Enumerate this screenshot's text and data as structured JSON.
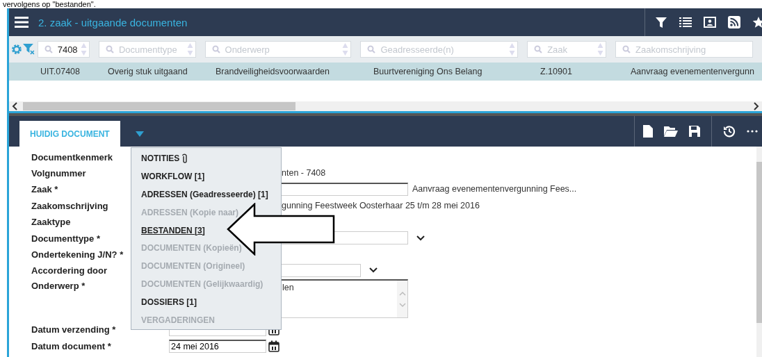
{
  "caption": "vervolgens op \"bestanden\".",
  "window": {
    "title": "2. zaak - uitgaande documenten"
  },
  "filters": [
    {
      "value": "7408"
    },
    {
      "placeholder": "Documenttype"
    },
    {
      "placeholder": "Onderwerp"
    },
    {
      "placeholder": "Geadresseerde(n)"
    },
    {
      "placeholder": "Zaak"
    },
    {
      "placeholder": "Zaakomschrijving"
    }
  ],
  "table": {
    "rows": [
      {
        "selected": true,
        "cells": [
          "UIT.07408",
          "Overig stuk uitgaand",
          "Brandveiligheidsvoorwaarden",
          "Buurtvereniging Ons Belang",
          "Z.10901",
          "Aanvraag evenementenvergunn"
        ]
      }
    ]
  },
  "tabs": [
    {
      "label": "HUIDIG DOCUMENT",
      "selected": true
    }
  ],
  "form": [
    {
      "label": "Documentkenmerk",
      "kind": "none"
    },
    {
      "label": "Volgnummer",
      "kind": "text",
      "value": "nten - 7408"
    },
    {
      "label": "Zaak *",
      "kind": "lookup",
      "value": "Aanvraag evenementenvergunning Fees..."
    },
    {
      "label": "Zaakomschrijving",
      "kind": "text",
      "value": "gunning Feestweek Oosterhaar 25 t/m 28 mei 2016"
    },
    {
      "label": "Zaaktype",
      "kind": "none"
    },
    {
      "label": "Documenttype *",
      "kind": "select"
    },
    {
      "label": "Ondertekening J/N? *",
      "kind": "none"
    },
    {
      "label": "Accordering door",
      "kind": "select-short"
    },
    {
      "label": "Onderwerp *",
      "kind": "textarea",
      "value": "len"
    },
    {
      "label": "Datum verzending *",
      "kind": "date"
    },
    {
      "label": "Datum document *",
      "kind": "date",
      "value": "24 mei 2016"
    }
  ],
  "menu": [
    {
      "label": "NOTITIES",
      "disabled": false,
      "selected": false,
      "attachment": true
    },
    {
      "label": "WORKFLOW [1]",
      "disabled": false,
      "selected": false,
      "attachment": false
    },
    {
      "label": "ADRESSEN (Geadresseerde) [1]",
      "disabled": false,
      "selected": false,
      "attachment": false
    },
    {
      "label": "ADRESSEN (Kopie naar)",
      "disabled": true,
      "selected": false,
      "attachment": false
    },
    {
      "label": "BESTANDEN [3]",
      "disabled": false,
      "selected": true,
      "attachment": false
    },
    {
      "label": "DOCUMENTEN (Kopieën)",
      "disabled": true,
      "selected": false,
      "attachment": false
    },
    {
      "label": "DOCUMENTEN (Origineel)",
      "disabled": true,
      "selected": false,
      "attachment": false
    },
    {
      "label": "DOCUMENTEN (Gelijkwaardig)",
      "disabled": true,
      "selected": false,
      "attachment": false
    },
    {
      "label": "DOSSIERS [1]",
      "disabled": false,
      "selected": false,
      "attachment": false
    },
    {
      "label": "VERGADERINGEN",
      "disabled": true,
      "selected": false,
      "attachment": false
    }
  ]
}
